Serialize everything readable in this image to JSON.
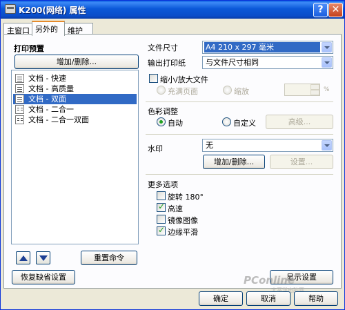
{
  "window": {
    "title": "K200(网络) 属性",
    "help_glyph": "?",
    "close_glyph": "✕"
  },
  "tabs": [
    {
      "label": "主窗口"
    },
    {
      "label": "另外的"
    },
    {
      "label": "维护"
    }
  ],
  "left": {
    "title": "打印预置",
    "add_delete_label": "增加/删除...",
    "presets": [
      {
        "label": "文档 - 快速",
        "icon": "document-icon"
      },
      {
        "label": "文档 - 高质量",
        "icon": "document-icon"
      },
      {
        "label": "文档 - 双面",
        "icon": "duplex-document-icon",
        "selected": true
      },
      {
        "label": "文档 - 二合一",
        "icon": "two-up-icon"
      },
      {
        "label": "文档 - 二合一双面",
        "icon": "two-up-icon"
      }
    ],
    "reset_command_label": "重置命令",
    "restore_defaults_label": "恢复缺省设置"
  },
  "right": {
    "doc_size_label": "文件尺寸",
    "doc_size_value": "A4 210 x 297 毫米",
    "output_paper_label": "输出打印纸",
    "output_paper_value": "与文件尺寸相同",
    "reduce_enlarge_label": "缩小/放大文件",
    "fit_page_label": "充满页面",
    "zoom_label": "缩放",
    "percent_symbol": "%",
    "color_adjust_label": "色彩调整",
    "auto_label": "自动",
    "custom_label": "自定义",
    "advanced_label": "高级...",
    "watermark_label": "水印",
    "watermark_value": "无",
    "wm_add_delete_label": "增加/删除...",
    "wm_settings_label": "设置...",
    "more_options_label": "更多选项",
    "options": [
      {
        "label": "旋转 180°",
        "checked": false
      },
      {
        "label": "高速",
        "checked": true
      },
      {
        "label": "镜像图像",
        "checked": false
      },
      {
        "label": "边缘平滑",
        "checked": true
      }
    ],
    "show_settings_label": "显示设置"
  },
  "footer": {
    "ok_label": "确定",
    "cancel_label": "取消",
    "help_label": "帮助"
  },
  "watermark_overlay": {
    "brand": "PConline",
    "sub": "太平洋电脑网"
  }
}
